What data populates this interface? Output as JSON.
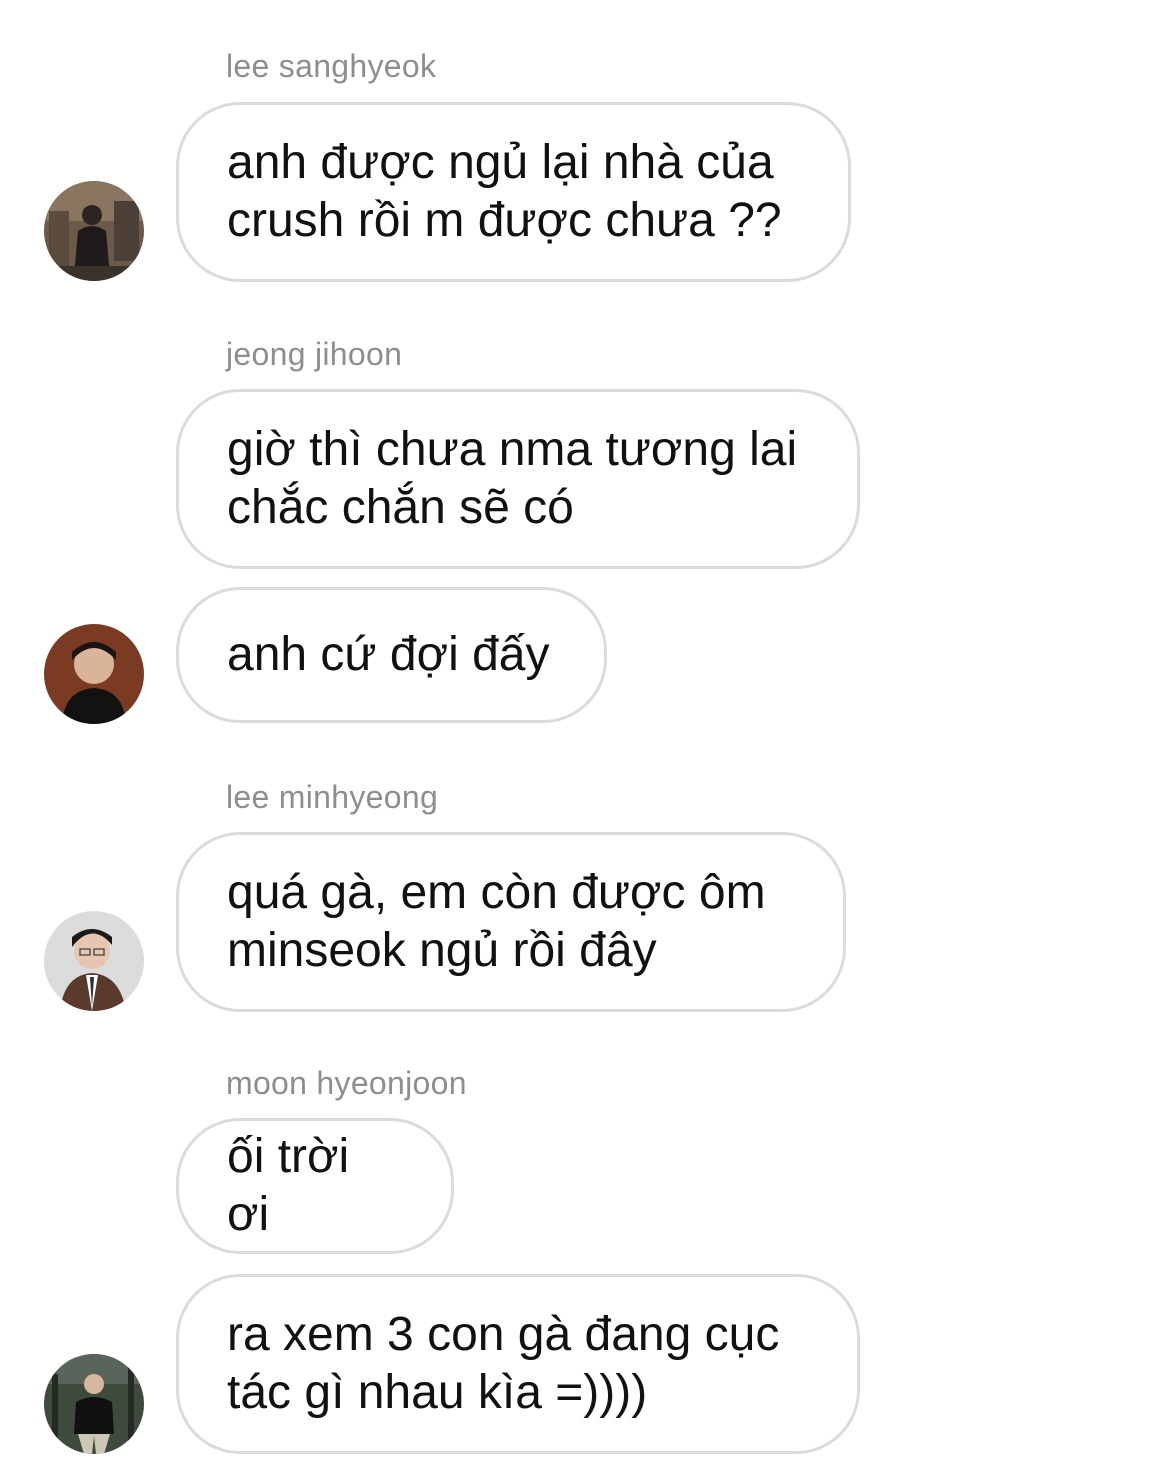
{
  "messages": [
    {
      "sender": "lee sanghyeok",
      "bubbles": [
        "anh được ngủ lại nhà của\ncrush rồi m được chưa ??"
      ],
      "avatar": "avatar-sanghyeok"
    },
    {
      "sender": "jeong jihoon",
      "bubbles": [
        "giờ thì chưa nma tương lai\nchắc chắn sẽ có",
        "anh cứ đợi đấy"
      ],
      "avatar": "avatar-jihoon"
    },
    {
      "sender": "lee minhyeong",
      "bubbles": [
        "quá gà, em còn được ôm\nminseok ngủ rồi đây"
      ],
      "avatar": "avatar-minhyeong"
    },
    {
      "sender": "moon hyeonjoon",
      "bubbles": [
        "ối trời ơi",
        "ra xem 3 con gà đang cục\ntác gì nhau kìa =))))"
      ],
      "avatar": "avatar-hyeonjoon"
    }
  ],
  "colors": {
    "bubble_border": "#dbdbdb",
    "sender_text": "#8e8e8e",
    "message_text": "#111111"
  }
}
